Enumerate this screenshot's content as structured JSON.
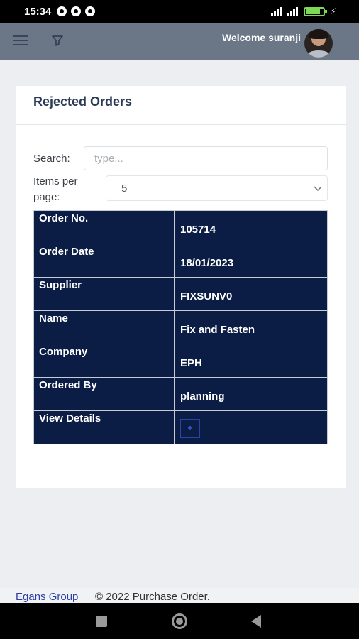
{
  "status_bar": {
    "time": "15:34"
  },
  "header": {
    "welcome": "Welcome suranji"
  },
  "card": {
    "title": "Rejected Orders",
    "search_label": "Search:",
    "search_placeholder": "type...",
    "items_per_page_label_1": "Items per",
    "items_per_page_label_2": "page:",
    "items_per_page_value": "5"
  },
  "order": {
    "rows": [
      {
        "label": "Order No.",
        "value": "105714"
      },
      {
        "label": "Order Date",
        "value": "18/01/2023"
      },
      {
        "label": "Supplier",
        "value": "FIXSUNV0"
      },
      {
        "label": "Name",
        "value": "Fix and Fasten"
      },
      {
        "label": "Company",
        "value": "EPH"
      },
      {
        "label": "Ordered By",
        "value": "planning"
      },
      {
        "label": "View Details",
        "value": ""
      }
    ],
    "view_button_icon": "+"
  },
  "footer": {
    "link": "Egans Group",
    "text": "© 2022 Purchase Order."
  },
  "colors": {
    "app_bar": "#6b7786",
    "table_bg": "#0c1d45",
    "title": "#2b3a55",
    "link": "#2e3fa8"
  }
}
